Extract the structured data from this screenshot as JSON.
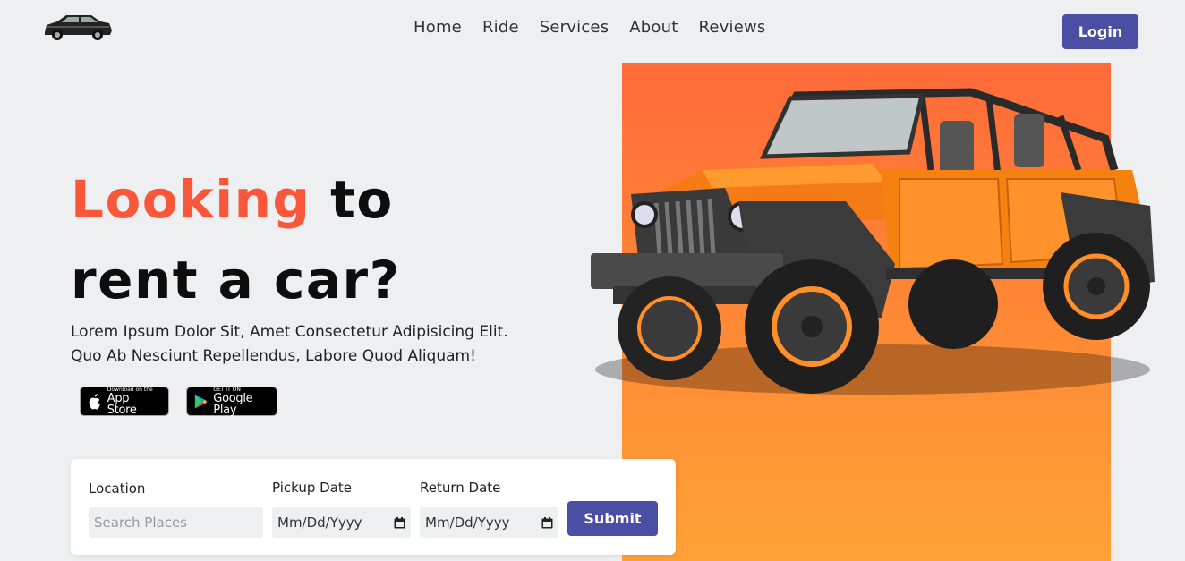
{
  "header": {
    "logo_icon": "sedan-car-icon",
    "nav": [
      "Home",
      "Ride",
      "Services",
      "About",
      "Reviews"
    ],
    "login_label": "Login"
  },
  "hero": {
    "title_accent": "Looking",
    "title_rest_line1": " to",
    "title_line2": "rent a car?",
    "description_line1": "Lorem Ipsum Dolor Sit, Amet Consectetur Adipisicing Elit.",
    "description_line2": "Quo Ab Nesciunt Repellendus, Labore Quod Aliquam!",
    "accent_color": "#f8573a",
    "app_store": {
      "small": "Download on the",
      "big": "App Store"
    },
    "google_play": {
      "small": "GET IT ON",
      "big": "Google Play"
    },
    "image": "orange-jeep-illustration"
  },
  "booking": {
    "location_label": "Location",
    "location_placeholder": "Search Places",
    "pickup_label": "Pickup Date",
    "pickup_value": "Mm/Dd/Yyyy",
    "return_label": "Return Date",
    "return_value": "Mm/Dd/Yyyy",
    "submit_label": "Submit"
  },
  "colors": {
    "primary": "#4b4fa3",
    "orange": "#ff8535",
    "background": "#eeeff1"
  }
}
